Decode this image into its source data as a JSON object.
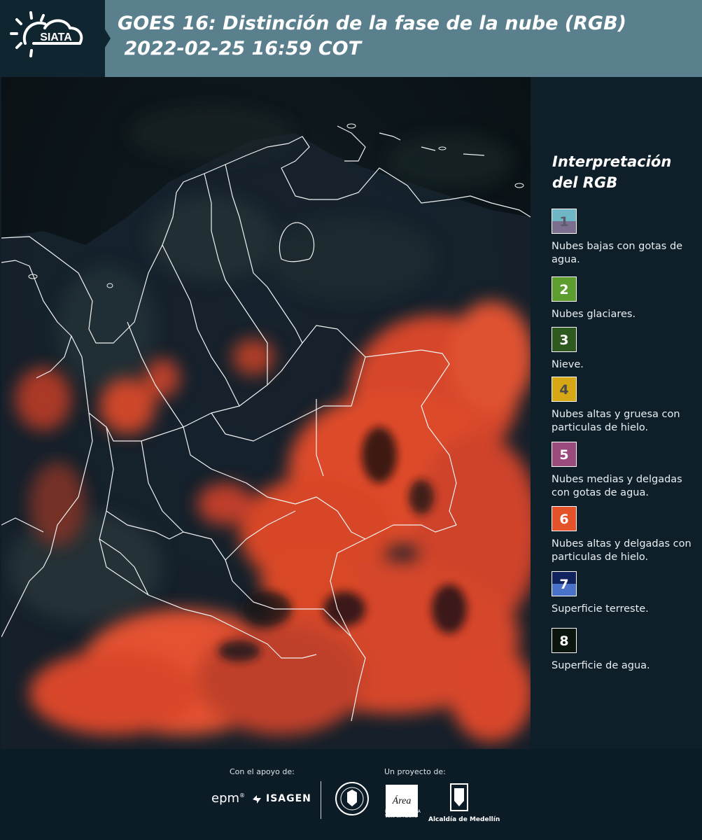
{
  "header": {
    "logo_text": "SIATA",
    "title_line1": "GOES 16: Distinción de la fase de la nube (RGB)",
    "title_line2": " 2022-02-25 16:59 COT"
  },
  "legend": {
    "title_line1": "Interpretación",
    "title_line2": "del RGB",
    "items": [
      {
        "num": "1",
        "label": "Nubes bajas con gotas de agua.",
        "color_top": "#6fb6c6",
        "color_bottom": "#7c6e8f",
        "num_color": "#5a5a6a"
      },
      {
        "num": "2",
        "label": "Nubes glaciares.",
        "color_top": "#5e9e2e",
        "color_bottom": "#5e9e2e",
        "num_color": "#ffffff"
      },
      {
        "num": "3",
        "label": "Nieve.",
        "color_top": "#2f5a1f",
        "color_bottom": "#2f5a1f",
        "num_color": "#ffffff"
      },
      {
        "num": "4",
        "label": "Nubes altas y gruesa con particulas de hielo.",
        "color_top": "#d7a815",
        "color_bottom": "#d7a815",
        "num_color": "#4a4a4a"
      },
      {
        "num": "5",
        "label": "Nubes medias y delgadas con gotas de agua.",
        "color_top": "#9b4a7e",
        "color_bottom": "#9b4a7e",
        "num_color": "#ffffff"
      },
      {
        "num": "6",
        "label": "Nubes altas y delgadas con particulas de hielo.",
        "color_top": "#e35228",
        "color_bottom": "#e35228",
        "num_color": "#ffffff"
      },
      {
        "num": "7",
        "label": "Superficie terreste.",
        "color_top": "#10235e",
        "color_bottom": "#4a72c8",
        "num_color": "#ffffff"
      },
      {
        "num": "8",
        "label": "Superficie de agua.",
        "color_top": "#0a150d",
        "color_bottom": "#0a150d",
        "num_color": "#ffffff"
      }
    ]
  },
  "footer": {
    "support_label": "Con el apoyo de:",
    "project_label": "Un proyecto de:",
    "epm": "epm",
    "isagen": "ISAGEN",
    "amva_text": "METROPOLITANA Valle de Aburrá",
    "amva_script": "Área",
    "alcaldia": "Alcaldía de Medellín"
  },
  "colors": {
    "header_bg": "#5a7f8d",
    "panel_bg": "#0e1f2a",
    "cloud_ice": "#f0532c",
    "land": "#14202c",
    "water": "#0a1410"
  }
}
